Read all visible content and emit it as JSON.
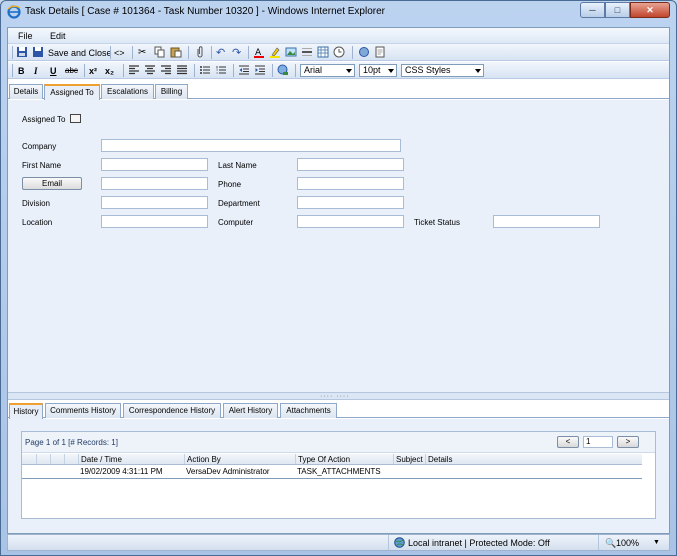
{
  "window": {
    "title": "Task Details [ Case # 101364 - Task Number 10320 ] - Windows Internet Explorer",
    "minimize": "─",
    "maximize": "□",
    "close": "✕"
  },
  "menu": {
    "file": "File",
    "edit": "Edit"
  },
  "toolbar": {
    "save_and_close": "Save and Close",
    "source": "<>",
    "bold": "B",
    "italic": "I",
    "underline": "U",
    "strike": "abc",
    "superscript": "x²",
    "subscript": "x₂",
    "font": "Arial",
    "size": "10pt",
    "styles": "CSS Styles"
  },
  "top_tabs": [
    "Details",
    "Assigned To",
    "Escalations",
    "Billing"
  ],
  "form": {
    "assigned_to": "Assigned To",
    "company": "Company",
    "first_name": "First Name",
    "last_name": "Last Name",
    "email": "Email",
    "phone": "Phone",
    "division": "Division",
    "department": "Department",
    "location": "Location",
    "computer": "Computer",
    "ticket_status": "Ticket Status"
  },
  "bottom_tabs": [
    "History",
    "Comments History",
    "Correspondence History",
    "Alert History",
    "Attachments"
  ],
  "history": {
    "pager_text": "Page 1 of 1 [# Records: 1]",
    "page_value": "1",
    "prev": "<",
    "next": ">",
    "columns": [
      "Date / Time",
      "Action By",
      "Type Of Action",
      "Subject",
      "Details"
    ],
    "rows": [
      [
        "19/02/2009 4:31:11 PM",
        "VersaDev  Administrator",
        "TASK_ATTACHMENTS",
        "",
        ""
      ]
    ]
  },
  "status": {
    "zone": "Local intranet | Protected Mode: Off",
    "zoom": "100%"
  },
  "colors": {
    "accent_tab": "#f0a030",
    "panel_bg": "#e9f0fa"
  }
}
